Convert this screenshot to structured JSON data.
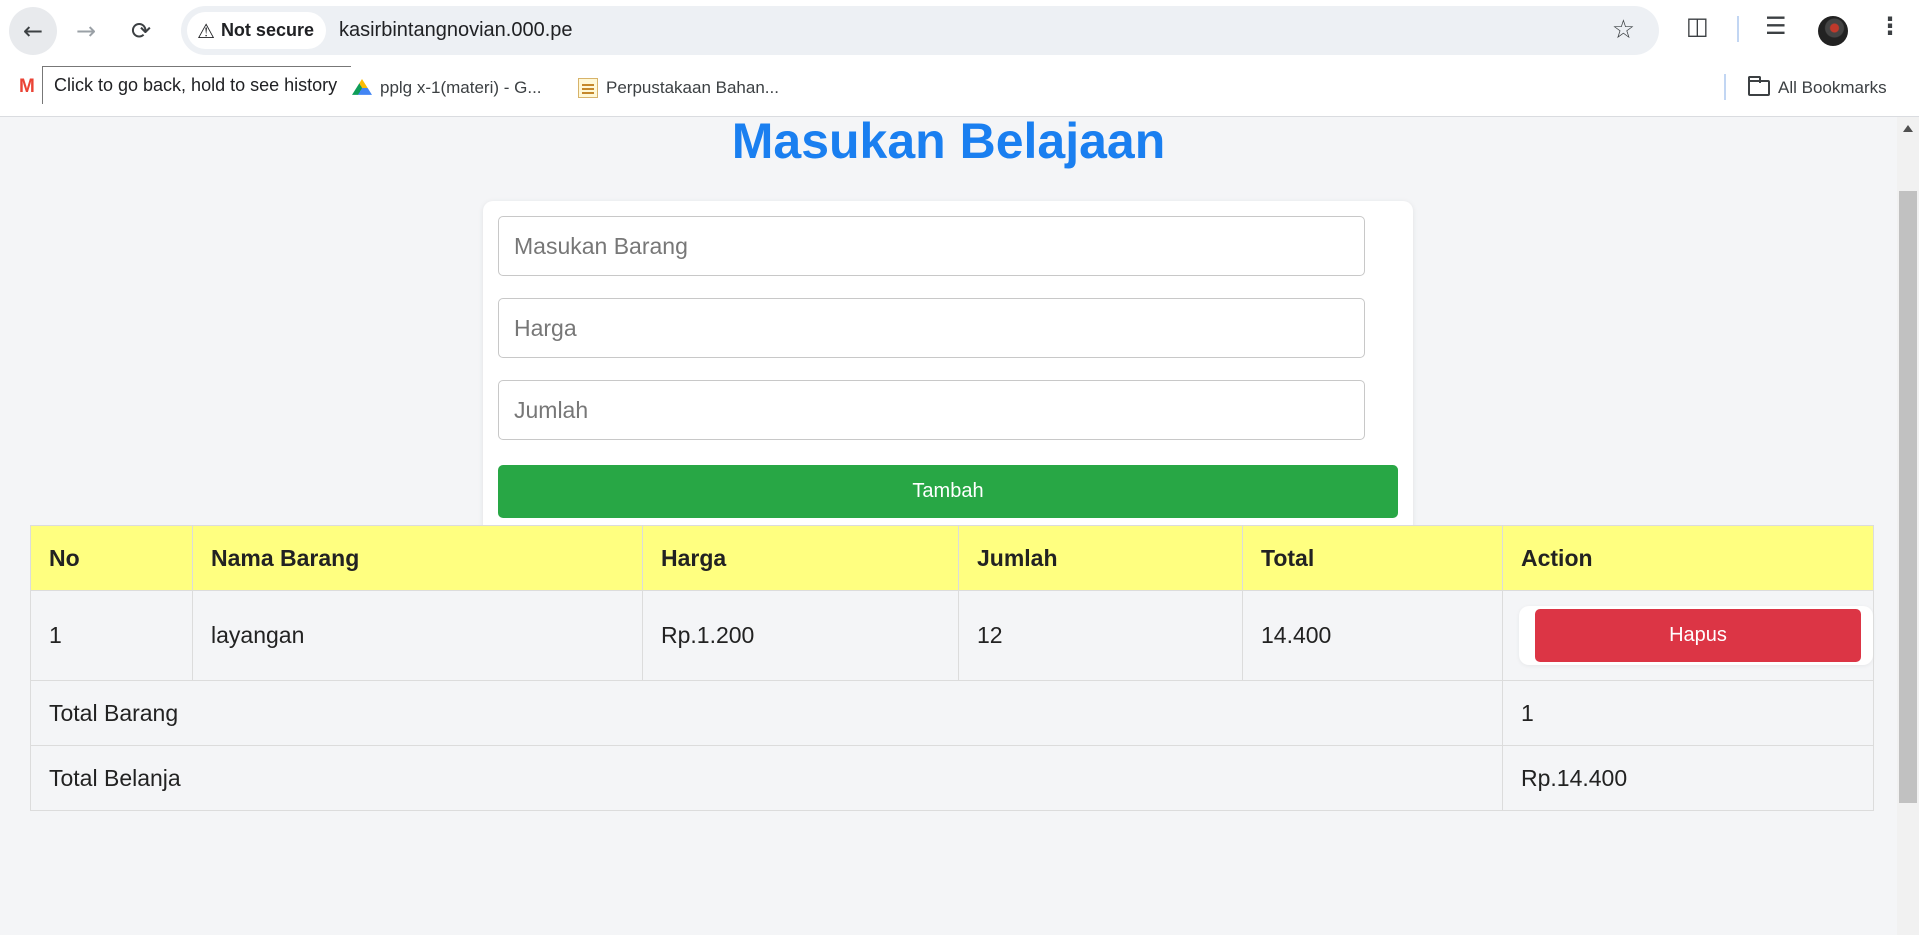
{
  "browser": {
    "security_label": "Not secure",
    "url": "kasirbintangnovian.000.pe",
    "tooltip": "Click to go back, hold to see history",
    "bookmarks": [
      {
        "label": "pplg x-1(materi) - G..."
      },
      {
        "label": "Perpustakaan Bahan..."
      }
    ],
    "all_bookmarks_label": "All Bookmarks"
  },
  "page": {
    "title": "Masukan Belajaan",
    "form": {
      "item_placeholder": "Masukan Barang",
      "price_placeholder": "Harga",
      "qty_placeholder": "Jumlah",
      "add_label": "Tambah"
    },
    "table": {
      "headers": [
        "No",
        "Nama Barang",
        "Harga",
        "Jumlah",
        "Total",
        "Action"
      ],
      "rows": [
        {
          "no": "1",
          "name": "layangan",
          "price": "Rp.1.200",
          "qty": "12",
          "total": "14.400",
          "action_label": "Hapus"
        }
      ],
      "summary": {
        "total_items_label": "Total Barang",
        "total_items_value": "1",
        "total_spend_label": "Total Belanja",
        "total_spend_value": "Rp.14.400"
      }
    }
  },
  "colors": {
    "title": "#1a7ff0",
    "add_button": "#28a745",
    "delete_button": "#dc3545",
    "table_header": "#ffff80"
  }
}
